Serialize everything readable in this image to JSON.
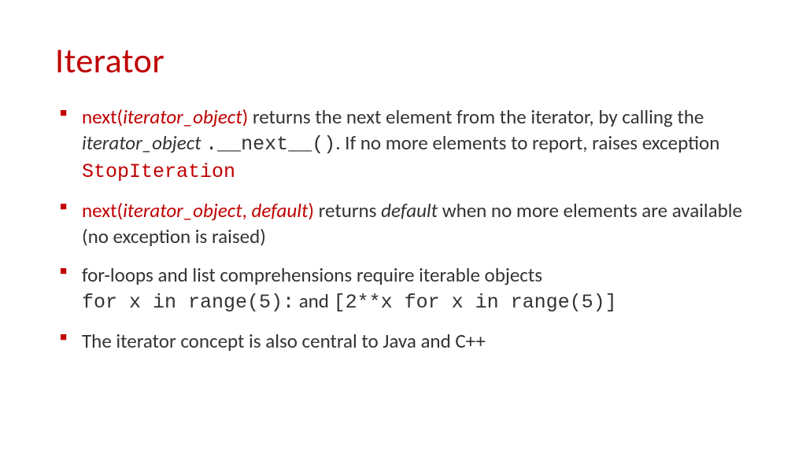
{
  "title": "Iterator",
  "bullets": [
    {
      "segments": [
        {
          "text": "next(",
          "cls": "red"
        },
        {
          "text": "iterator_object",
          "cls": "red ital"
        },
        {
          "text": ")",
          "cls": "red"
        },
        {
          "text": " returns the next element from the iterator, by calling the ",
          "cls": ""
        },
        {
          "text": "iterator_object",
          "cls": "ital"
        },
        {
          "text": " ",
          "cls": ""
        },
        {
          "text": ".__next__()",
          "cls": "mono"
        },
        {
          "text": ". If no more elements to report, raises exception ",
          "cls": ""
        },
        {
          "text": "StopIteration",
          "cls": "mono-red"
        }
      ]
    },
    {
      "segments": [
        {
          "text": "next(",
          "cls": "red"
        },
        {
          "text": "iterator_object",
          "cls": "red ital"
        },
        {
          "text": ", ",
          "cls": "red"
        },
        {
          "text": "default",
          "cls": "red ital"
        },
        {
          "text": ")",
          "cls": "red"
        },
        {
          "text": " returns ",
          "cls": ""
        },
        {
          "text": "default",
          "cls": "ital"
        },
        {
          "text": " when no more elements are available (no exception is raised)",
          "cls": ""
        }
      ]
    },
    {
      "segments": [
        {
          "text": "for-loops and list comprehensions require iterable objects",
          "cls": ""
        },
        {
          "text": "\n",
          "cls": "br"
        },
        {
          "text": "for x in range(5):",
          "cls": "mono"
        },
        {
          "text": " and ",
          "cls": ""
        },
        {
          "text": "[2**x for x in range(5)]",
          "cls": "mono"
        }
      ]
    },
    {
      "segments": [
        {
          "text": "The iterator concept is also central to Java and C++",
          "cls": ""
        }
      ]
    }
  ]
}
